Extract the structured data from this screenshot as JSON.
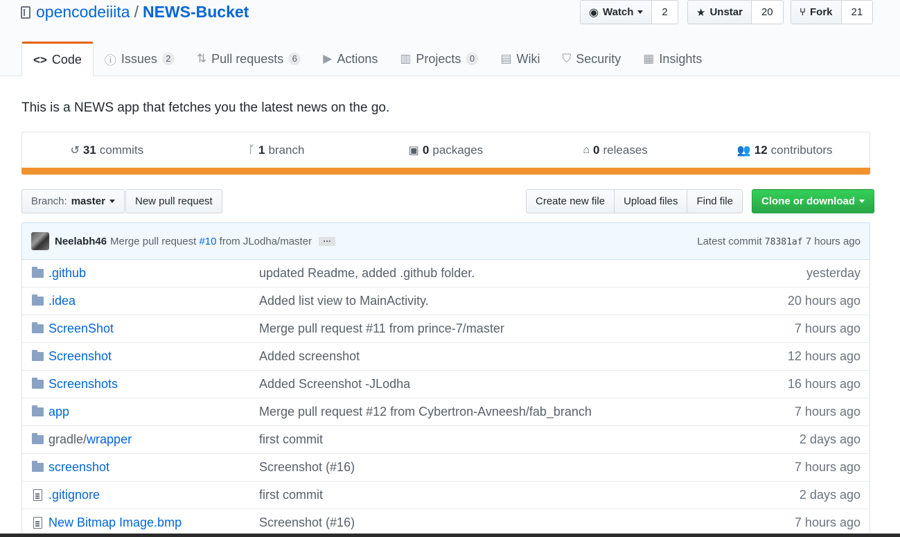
{
  "repo": {
    "owner": "opencodeiiita",
    "separator": "/",
    "name": "NEWS-Bucket"
  },
  "actions": {
    "watch": {
      "label": "Watch",
      "count": "2"
    },
    "star": {
      "label": "Unstar",
      "count": "20"
    },
    "fork": {
      "label": "Fork",
      "count": "21"
    }
  },
  "tabs": [
    {
      "label": "Code",
      "icon": "code-icon",
      "counter": null
    },
    {
      "label": "Issues",
      "icon": "issue-icon",
      "counter": "2"
    },
    {
      "label": "Pull requests",
      "icon": "pull-request-icon",
      "counter": "6"
    },
    {
      "label": "Actions",
      "icon": "play-icon",
      "counter": null
    },
    {
      "label": "Projects",
      "icon": "project-icon",
      "counter": "0"
    },
    {
      "label": "Wiki",
      "icon": "book-icon",
      "counter": null
    },
    {
      "label": "Security",
      "icon": "shield-icon",
      "counter": null
    },
    {
      "label": "Insights",
      "icon": "graph-icon",
      "counter": null
    }
  ],
  "description": "This is a NEWS app that fetches you the latest news on the go.",
  "summary": {
    "commits": {
      "num": "31",
      "label": "commits"
    },
    "branches": {
      "num": "1",
      "label": "branch"
    },
    "packages": {
      "num": "0",
      "label": "packages"
    },
    "releases": {
      "num": "0",
      "label": "releases"
    },
    "contributors": {
      "num": "12",
      "label": "contributors"
    }
  },
  "language_color": "#f1922f",
  "toolbar": {
    "branch_label": "Branch:",
    "branch_value": "master",
    "new_pr": "New pull request",
    "create_file": "Create new file",
    "upload_files": "Upload files",
    "find_file": "Find file",
    "clone": "Clone or download"
  },
  "latest_commit": {
    "author": "Neelabh46",
    "msg_before": "Merge pull request",
    "pr": "#10",
    "msg_after": "from JLodha/master",
    "ellipsis": "…",
    "label": "Latest commit",
    "sha": "78381af",
    "age": "7 hours ago"
  },
  "files": [
    {
      "type": "dir",
      "name": ".github",
      "dim": "",
      "msg": "updated Readme, added .github folder.",
      "age": "yesterday"
    },
    {
      "type": "dir",
      "name": ".idea",
      "dim": "",
      "msg": "Added list view to MainActivity.",
      "age": "20 hours ago"
    },
    {
      "type": "dir",
      "name": "ScreenShot",
      "dim": "",
      "msg": "Merge pull request #11 from prince-7/master",
      "age": "7 hours ago"
    },
    {
      "type": "dir",
      "name": "Screenshot",
      "dim": "",
      "msg": "Added screenshot",
      "age": "12 hours ago"
    },
    {
      "type": "dir",
      "name": "Screenshots",
      "dim": "",
      "msg": "Added Screenshot -JLodha",
      "age": "16 hours ago"
    },
    {
      "type": "dir",
      "name": "app",
      "dim": "",
      "msg": "Merge pull request #12 from Cybertron-Avneesh/fab_branch",
      "age": "7 hours ago"
    },
    {
      "type": "dir",
      "name": "wrapper",
      "dim": "gradle/",
      "msg": "first commit",
      "age": "2 days ago"
    },
    {
      "type": "dir",
      "name": "screenshot",
      "dim": "",
      "msg": "Screenshot (#16)",
      "age": "7 hours ago"
    },
    {
      "type": "file",
      "name": ".gitignore",
      "dim": "",
      "msg": "first commit",
      "age": "2 days ago"
    },
    {
      "type": "file",
      "name": "New Bitmap Image.bmp",
      "dim": "",
      "msg": "Screenshot (#16)",
      "age": "7 hours ago"
    }
  ]
}
